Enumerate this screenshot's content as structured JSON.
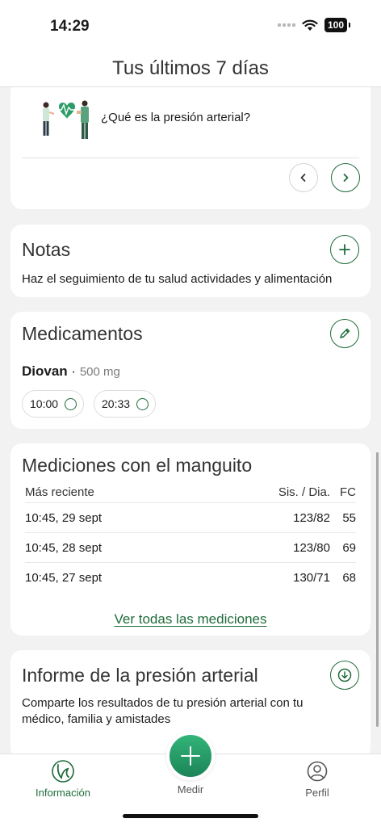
{
  "status_bar": {
    "time": "14:29",
    "battery": "100"
  },
  "header": {
    "title": "Tus últimos 7 días"
  },
  "info_card": {
    "text": "¿Qué es la presión arterial?"
  },
  "notas": {
    "title": "Notas",
    "subtitle": "Haz el seguimiento de tu salud actividades y alimentación"
  },
  "medicamentos": {
    "title": "Medicamentos",
    "name": "Diovan",
    "separator": "·",
    "dose": "500 mg",
    "times": [
      "10:00",
      "20:33"
    ]
  },
  "mediciones": {
    "title": "Mediciones con el manguito",
    "headers": {
      "recent": "Más reciente",
      "sysdia": "Sis. / Dia.",
      "fc": "FC"
    },
    "rows": [
      {
        "date": "10:45, 29 sept",
        "bp": "123/82",
        "fc": "55"
      },
      {
        "date": "10:45, 28 sept",
        "bp": "123/80",
        "fc": "69"
      },
      {
        "date": "10:45, 27 sept",
        "bp": "130/71",
        "fc": "68"
      }
    ],
    "link": "Ver todas las mediciones"
  },
  "informe": {
    "title": "Informe de la presión arterial",
    "text": "Comparte los resultados de tu presión arterial con tu médico, familia y amistades"
  },
  "tabs": {
    "info": "Información",
    "medir": "Medir",
    "perfil": "Perfil"
  },
  "colors": {
    "accent": "#1f6b3a",
    "fab": "#28a36a"
  }
}
